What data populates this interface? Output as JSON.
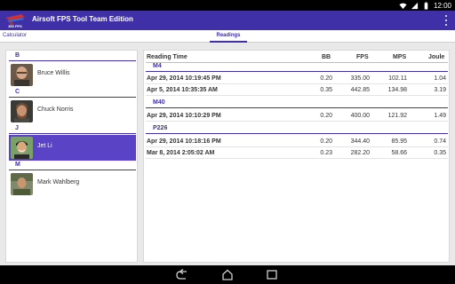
{
  "status_bar": {
    "time": "12:00",
    "icons": [
      "wifi-icon",
      "signal-icon",
      "battery-icon"
    ]
  },
  "app": {
    "title": "Airsoft FPS Tool Team Edition",
    "logo_caption": "350 FPS"
  },
  "tabs": [
    {
      "label": "Calculator",
      "active": false
    },
    {
      "label": "Readings",
      "active": true
    }
  ],
  "people": [
    {
      "section": "B",
      "name": "Bruce Willis",
      "selected": false
    },
    {
      "section": "C",
      "name": "Chuck Norris",
      "selected": false
    },
    {
      "section": "J",
      "name": "Jet Li",
      "selected": true
    },
    {
      "section": "M",
      "name": "Mark Wahlberg",
      "selected": false
    }
  ],
  "readings": {
    "columns": [
      "Reading Time",
      "BB",
      "FPS",
      "MPS",
      "Joule"
    ],
    "groups": [
      {
        "gun": "M4",
        "rows": [
          {
            "time": "Apr 29, 2014 10:19:45 PM",
            "bb": "0.20",
            "fps": "335.00",
            "mps": "102.11",
            "joule": "1.04"
          },
          {
            "time": "Apr 5, 2014 10:35:35 AM",
            "bb": "0.35",
            "fps": "442.85",
            "mps": "134.98",
            "joule": "3.19"
          }
        ]
      },
      {
        "gun": "M40",
        "rows": [
          {
            "time": "Apr 29, 2014 10:10:29 PM",
            "bb": "0.20",
            "fps": "400.00",
            "mps": "121.92",
            "joule": "1.49"
          }
        ]
      },
      {
        "gun": "P226",
        "rows": [
          {
            "time": "Apr 29, 2014 10:18:16 PM",
            "bb": "0.20",
            "fps": "344.40",
            "mps": "85.95",
            "joule": "0.74"
          },
          {
            "time": "Mar 8, 2014 2:05:02 AM",
            "bb": "0.23",
            "fps": "282.20",
            "mps": "58.66",
            "joule": "0.35"
          }
        ]
      }
    ]
  },
  "nav": {
    "icons": [
      "back-icon",
      "home-icon",
      "recent-apps-icon"
    ]
  },
  "colors": {
    "primary": "#3f30a8",
    "selected_row": "#5a43c4",
    "background": "#e9e9e9"
  }
}
